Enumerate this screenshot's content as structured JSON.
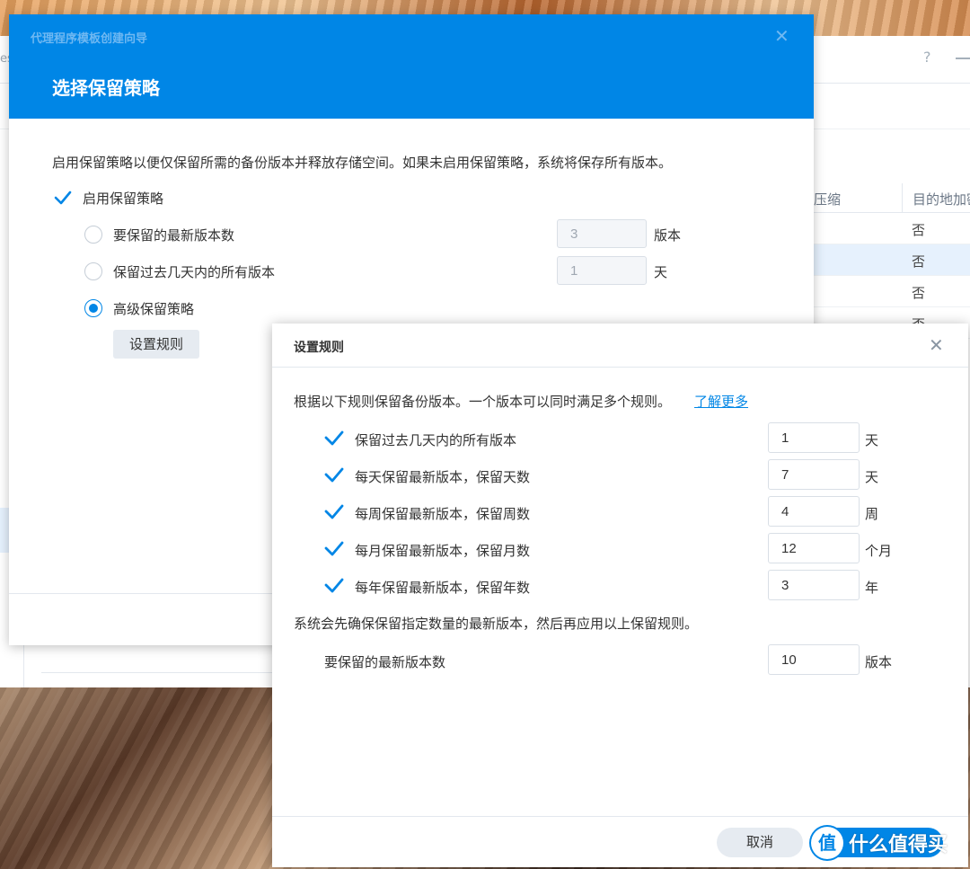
{
  "background_app": {
    "title_fragment": "es",
    "help_icon": "?",
    "table": {
      "columns": [
        "压缩",
        "目的地加密"
      ],
      "rows": [
        "否",
        "否",
        "否",
        "否"
      ],
      "selected_row": 1
    }
  },
  "wizard": {
    "window_title": "代理程序模板创建向导",
    "step_title": "选择保留策略",
    "description": "启用保留策略以便仅保留所需的备份版本并释放存储空间。如果未启用保留策略，系统将保存所有版本。",
    "enable_checkbox": {
      "label": "启用保留策略",
      "checked": true
    },
    "options": [
      {
        "label": "要保留的最新版本数",
        "value": "3",
        "unit": "版本",
        "selected": false
      },
      {
        "label": "保留过去几天内的所有版本",
        "value": "1",
        "unit": "天",
        "selected": false
      },
      {
        "label": "高级保留策略",
        "selected": true
      }
    ],
    "set_rules_button": "设置规则"
  },
  "rules_dialog": {
    "title": "设置规则",
    "description": "根据以下规则保留备份版本。一个版本可以同时满足多个规则。",
    "learn_more_link": "了解更多",
    "rules": [
      {
        "label": "保留过去几天内的所有版本",
        "value": "1",
        "unit": "天",
        "checked": true
      },
      {
        "label": "每天保留最新版本，保留天数",
        "value": "7",
        "unit": "天",
        "checked": true
      },
      {
        "label": "每周保留最新版本，保留周数",
        "value": "4",
        "unit": "周",
        "checked": true
      },
      {
        "label": "每月保留最新版本，保留月数",
        "value": "12",
        "unit": "个月",
        "checked": true
      },
      {
        "label": "每年保留最新版本，保留年数",
        "value": "3",
        "unit": "年",
        "checked": true
      }
    ],
    "note": "系统会先确保保留指定数量的最新版本，然后再应用以上保留规则。",
    "latest_versions": {
      "label": "要保留的最新版本数",
      "value": "10",
      "unit": "版本"
    },
    "cancel_button": "取消"
  },
  "watermark": {
    "badge": "值",
    "text": "什么值得买"
  },
  "colors": {
    "accent": "#0086e6",
    "check": "#0086e6"
  }
}
